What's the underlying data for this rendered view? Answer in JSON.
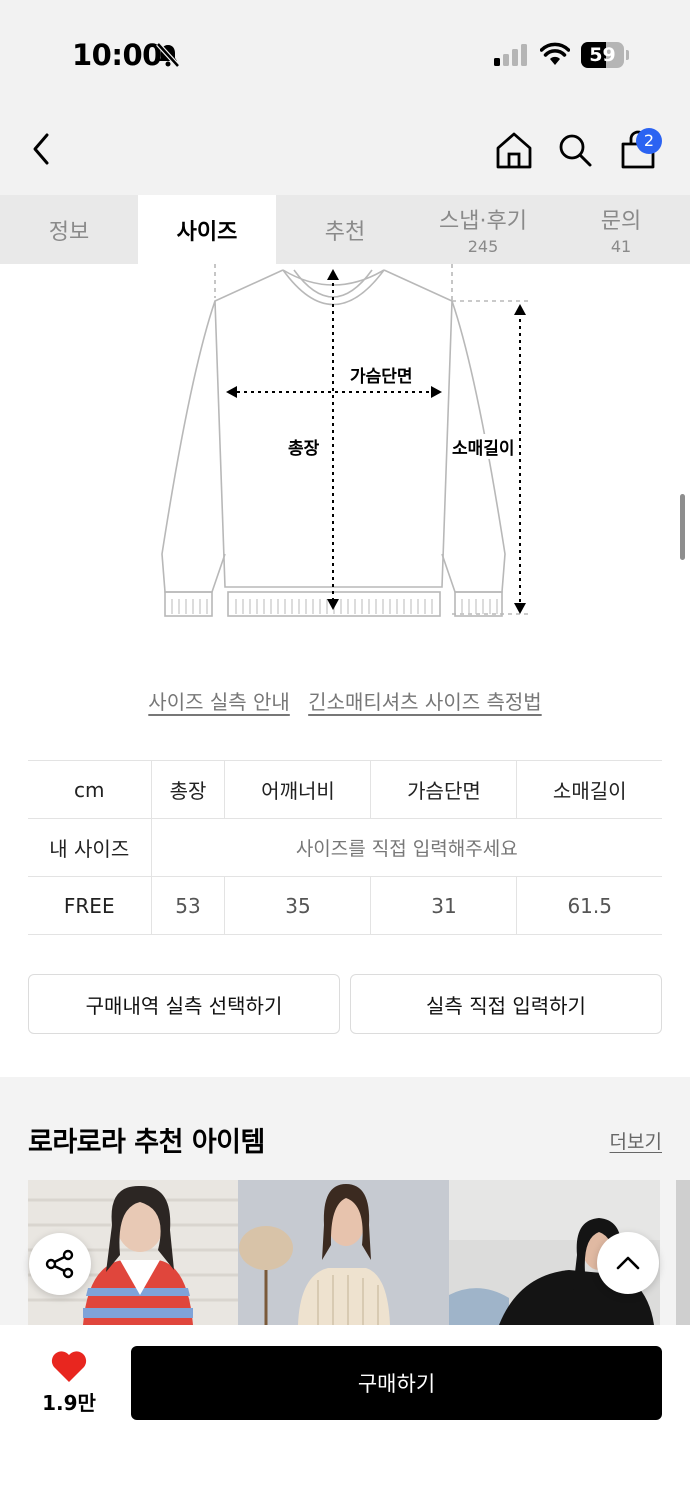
{
  "status_bar": {
    "time": "10:00",
    "battery": "59",
    "battery_level": 0.59
  },
  "header": {
    "cart_count": "2"
  },
  "tabs": [
    {
      "label": "정보",
      "count": ""
    },
    {
      "label": "사이즈",
      "count": ""
    },
    {
      "label": "추천",
      "count": ""
    },
    {
      "label": "스냅·후기",
      "count": "245"
    },
    {
      "label": "문의",
      "count": "41"
    }
  ],
  "diagram": {
    "chest": "가슴단면",
    "length": "총장",
    "sleeve": "소매길이"
  },
  "links": {
    "guide": "사이즈 실측 안내",
    "method": "긴소매티셔츠 사이즈 측정법"
  },
  "size_table": {
    "unit": "cm",
    "headers": [
      "총장",
      "어깨너비",
      "가슴단면",
      "소매길이"
    ],
    "my_size_label": "내 사이즈",
    "my_size_hint": "사이즈를 직접 입력해주세요",
    "rows": [
      {
        "size": "FREE",
        "values": [
          "53",
          "35",
          "31",
          "61.5"
        ]
      }
    ]
  },
  "buttons": {
    "purchase_history": "구매내역 실측 선택하기",
    "direct_input": "실측 직접 입력하기"
  },
  "recommend": {
    "title": "로라로라 추천 아이템",
    "more": "더보기"
  },
  "bottom_bar": {
    "likes": "1.9만",
    "buy": "구매하기"
  },
  "colors": {
    "accent_badge": "#2b63f2",
    "heart": "#e8261f",
    "buy_button": "#000000"
  },
  "icons": [
    "bell-slash-icon",
    "signal-icon",
    "wifi-icon",
    "back-icon",
    "home-icon",
    "search-icon",
    "bag-icon",
    "share-icon",
    "chevron-up-icon",
    "heart-icon"
  ]
}
